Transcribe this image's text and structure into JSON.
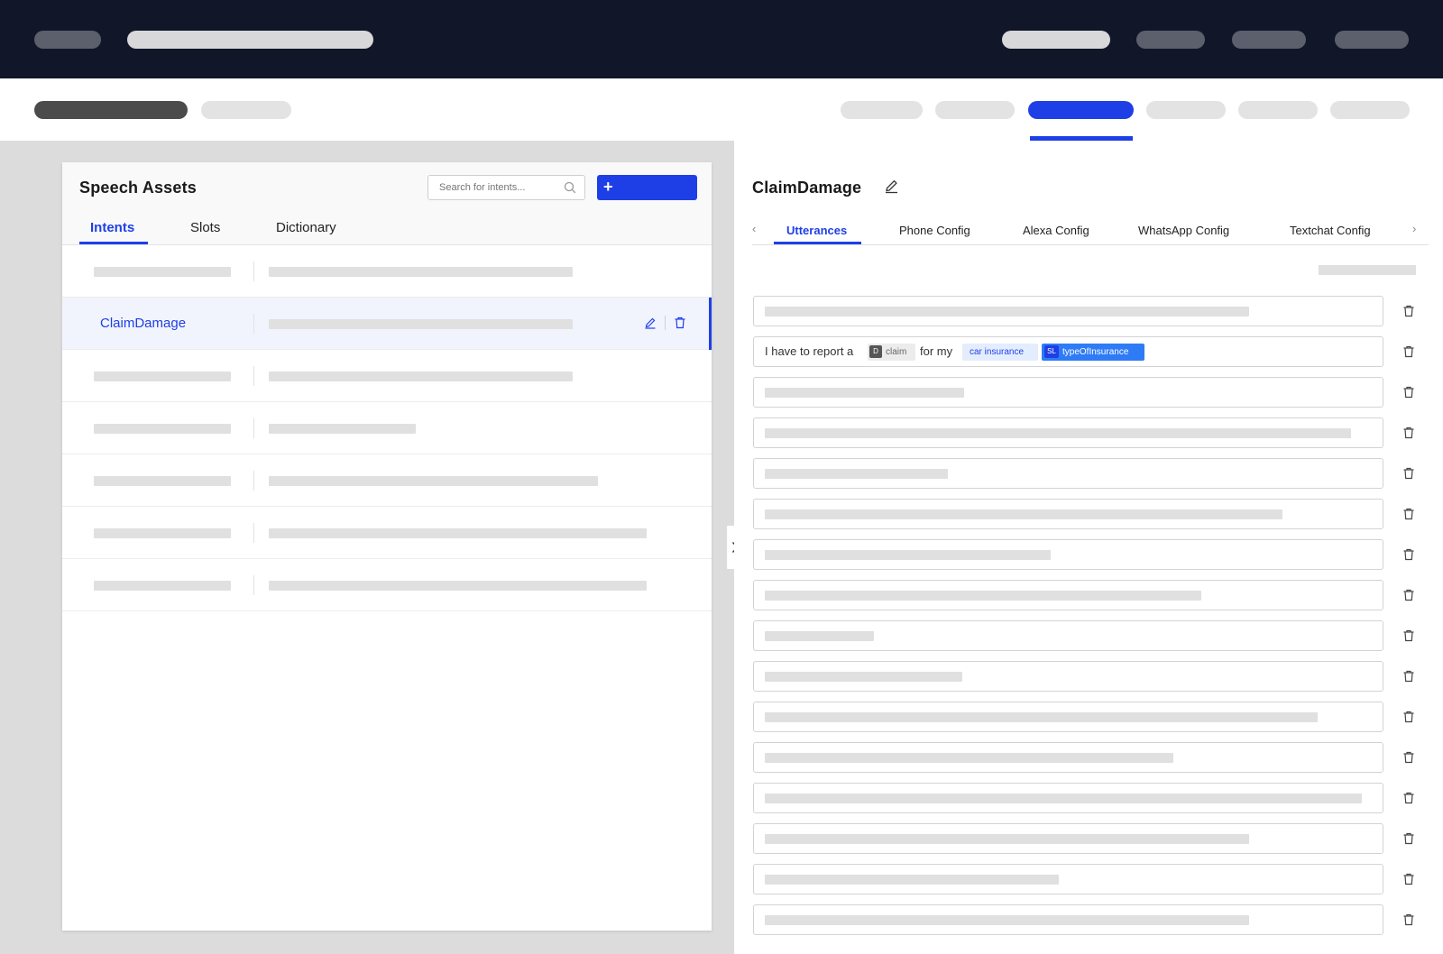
{
  "colors": {
    "accent": "#1e3fe6",
    "topbar": "#111729",
    "slot_chip": "#2f7bf6",
    "entity_chip_bg": "#e3edfe"
  },
  "left": {
    "title": "Speech Assets",
    "search_placeholder": "Search for intents...",
    "add_button_icon": "+",
    "tabs": [
      {
        "label": "Intents",
        "active": true
      },
      {
        "label": "Slots",
        "active": false
      },
      {
        "label": "Dictionary",
        "active": false
      }
    ],
    "selected_intent": "ClaimDamage"
  },
  "right": {
    "title": "ClaimDamage",
    "tabs": [
      {
        "label": "Utterances",
        "active": true
      },
      {
        "label": "Phone Config",
        "active": false
      },
      {
        "label": "Alexa Config",
        "active": false
      },
      {
        "label": "WhatsApp Config",
        "active": false
      },
      {
        "label": "Textchat Config",
        "active": false
      }
    ],
    "tab_prev": "‹",
    "tab_next": "›",
    "utterance": {
      "text_1": "I have to report a",
      "dict_tag": "D",
      "dict_value": "claim",
      "text_2": "for my",
      "entity_value": "car insurance",
      "slot_tag": "SL",
      "slot_name": "typeOfInsurance"
    }
  },
  "icons": [
    "search-icon",
    "plus-icon",
    "edit-icon",
    "trash-icon",
    "chevron-right-icon",
    "chevron-left-icon"
  ]
}
